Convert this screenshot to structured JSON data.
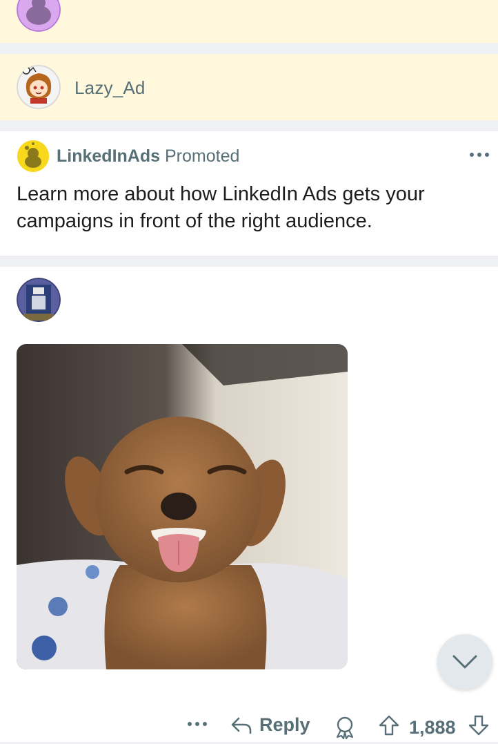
{
  "comments": {
    "second_username": "Lazy_Ad"
  },
  "ad": {
    "name": "LinkedInAds",
    "promoted_label": "Promoted",
    "body": "Learn more about how LinkedIn Ads gets your campaigns in front of the right audience."
  },
  "image_comment": {
    "actions": {
      "reply_label": "Reply",
      "vote_count": "1,888"
    }
  },
  "icons": [
    "snoo-avatar-icon",
    "more-options-icon",
    "reply-arrow-icon",
    "award-icon",
    "upvote-icon",
    "downvote-icon",
    "chevron-down-icon"
  ],
  "colors": {
    "highlight_bg": "#fff8dc",
    "separator": "#eef0f3",
    "meta_text": "#576f76",
    "collapse_button_bg": "#e3e8ec"
  }
}
